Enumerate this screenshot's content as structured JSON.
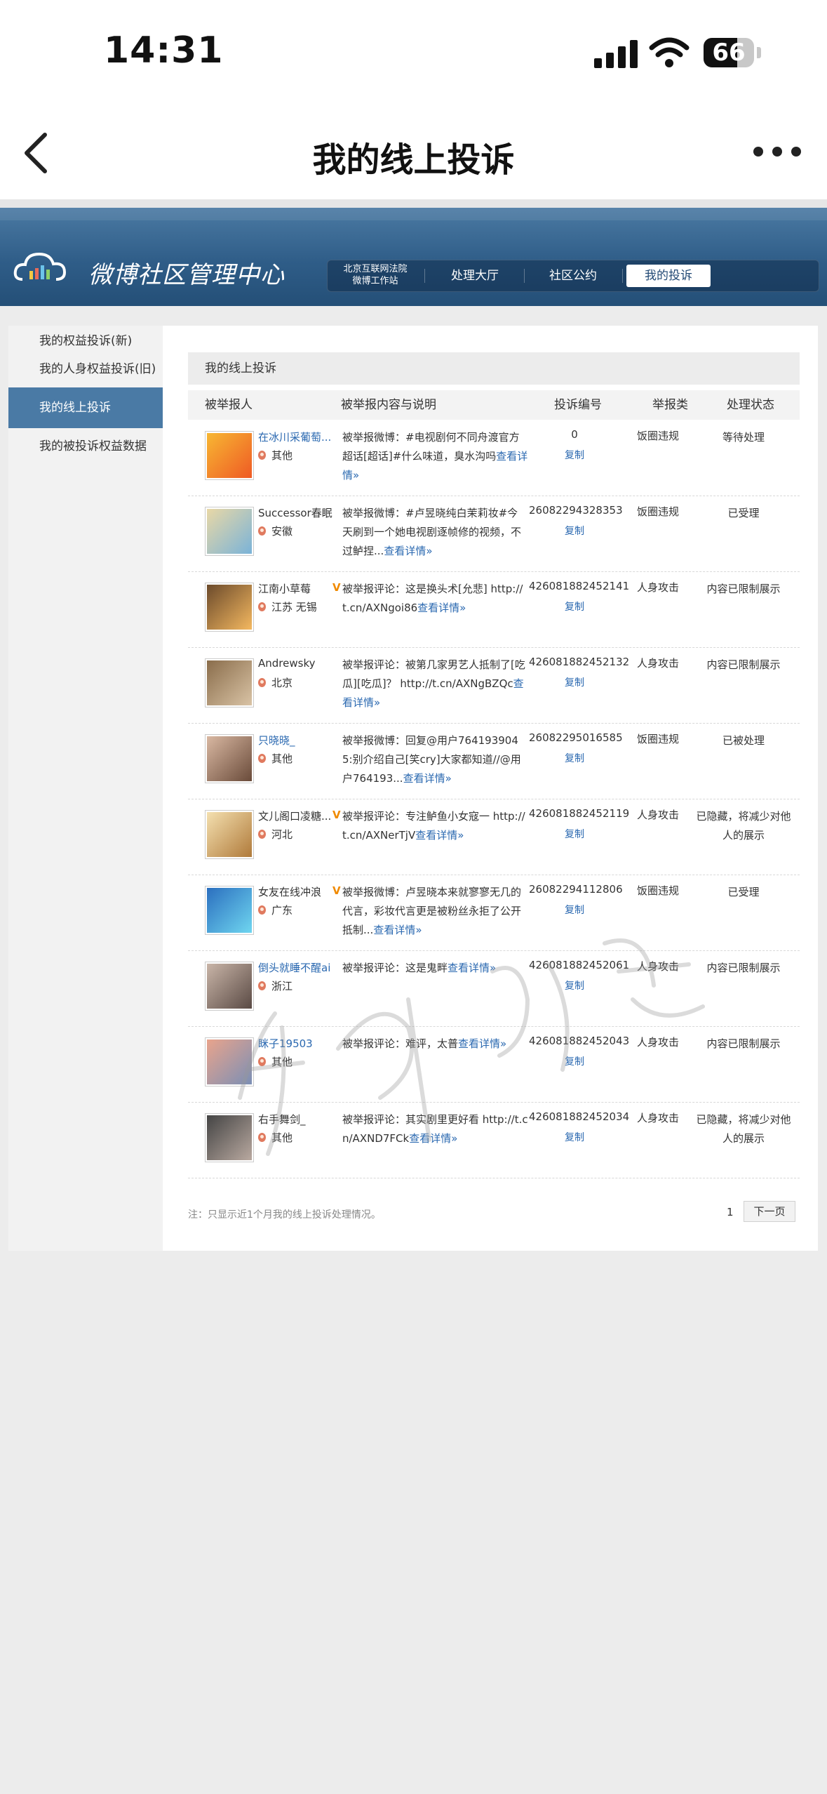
{
  "status_bar": {
    "time": "14:31",
    "battery": "66",
    "battery_level": 0.66
  },
  "nav": {
    "title": "我的线上投诉",
    "back_icon": "chevron-left-icon",
    "more_icon": "more-dots-icon"
  },
  "banner": {
    "logo_text": "微博社区管理中心",
    "court_line1": "北京互联网法院",
    "court_line2": "微博工作站",
    "tabs": [
      {
        "label": "处理大厅",
        "active": false
      },
      {
        "label": "社区公约",
        "active": false
      },
      {
        "label": "我的投诉",
        "active": true
      }
    ]
  },
  "sidebar": {
    "items": [
      {
        "label": "我的权益投诉(新)",
        "active": false
      },
      {
        "label": "我的人身权益投诉(旧)",
        "active": false
      },
      {
        "label": "我的线上投诉",
        "active": true
      },
      {
        "label": "我的被投诉权益数据",
        "active": false
      }
    ]
  },
  "content": {
    "box_title": "我的线上投诉",
    "columns": [
      "被举报人",
      "被举报内容与说明",
      "投诉编号",
      "举报类",
      "处理状态"
    ],
    "copy_label": "复制",
    "more_label": "查看详情»",
    "rows": [
      {
        "name": "在冰川采葡萄...",
        "name_link": true,
        "verified": false,
        "location": "其他",
        "desc": "被举报微博：#电视剧何不同舟渡官方超话[超话]#什么味道，臭水沟吗",
        "id": "0",
        "type": "饭圈违规",
        "status": "等待处理"
      },
      {
        "name": "Successor春眠",
        "name_link": false,
        "verified": false,
        "location": "安徽",
        "desc": "被举报微博：#卢昱晓纯白茉莉妆#今天刷到一个她电视剧逐帧修的视频，不过鲈捏...",
        "id": "26082294328353",
        "type": "饭圈违规",
        "status": "已受理"
      },
      {
        "name": "江南小草莓",
        "name_link": false,
        "verified": true,
        "location": "江苏 无锡",
        "desc": "被举报评论：这是换头术[允悲] http://t.cn/AXNgoi86",
        "id": "426081882452141",
        "type": "人身攻击",
        "status": "内容已限制展示"
      },
      {
        "name": "Andrewsky",
        "name_link": false,
        "verified": false,
        "location": "北京",
        "desc": "被举报评论：被第几家男艺人抵制了[吃瓜][吃瓜]？ http://t.cn/AXNgBZQc",
        "id": "426081882452132",
        "type": "人身攻击",
        "status": "内容已限制展示"
      },
      {
        "name": "只晓晓_",
        "name_link": true,
        "verified": false,
        "location": "其他",
        "desc": "被举报微博：回复@用户7641939045:别介绍自己[笑cry]大家都知道//@用户764193...",
        "id": "26082295016585",
        "type": "饭圈违规",
        "status": "已被处理"
      },
      {
        "name": "文儿阁口凌糖...",
        "name_link": false,
        "verified": true,
        "location": "河北",
        "desc": "被举报评论：专注鲈鱼小女寇一 http://t.cn/AXNerTjV",
        "id": "426081882452119",
        "type": "人身攻击",
        "status": "已隐藏，将减少对他人的展示"
      },
      {
        "name": "女友在线冲浪",
        "name_link": false,
        "verified": true,
        "location": "广东",
        "desc": "被举报微博：卢昱晓本来就寥寥无几的代言，彩妆代言更是被粉丝永拒了公开抵制...",
        "id": "26082294112806",
        "type": "饭圈违规",
        "status": "已受理"
      },
      {
        "name": "倒头就睡不醒ai",
        "name_link": true,
        "verified": false,
        "location": "浙江",
        "desc": "被举报评论：这是鬼畔",
        "id": "426081882452061",
        "type": "人身攻击",
        "status": "内容已限制展示"
      },
      {
        "name": "眯子19503",
        "name_link": true,
        "verified": false,
        "location": "其他",
        "desc": "被举报评论：难评，太普",
        "id": "426081882452043",
        "type": "人身攻击",
        "status": "内容已限制展示"
      },
      {
        "name": "右手舞剑_",
        "name_link": false,
        "verified": false,
        "location": "其他",
        "desc": "被举报评论：其实剧里更好看 http://t.cn/AXND7FCk",
        "id": "426081882452034",
        "type": "人身攻击",
        "status": "已隐藏，将减少对他人的展示"
      }
    ],
    "footnote": "注：只显示近1个月我的线上投诉处理情况。",
    "page_number": "1",
    "next_page": "下一页"
  },
  "colors": {
    "banner": "#2f5d88",
    "link": "#2a68b0",
    "active_side": "#4a7aa5",
    "verified": "#f08a00"
  }
}
